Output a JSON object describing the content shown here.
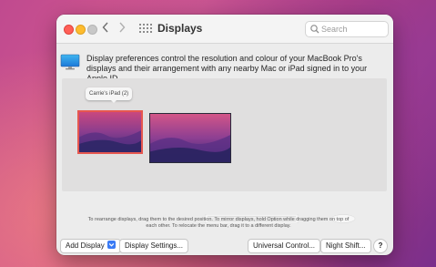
{
  "window": {
    "title": "Displays",
    "search": {
      "placeholder": "Search"
    }
  },
  "description": "Display preferences control the resolution and colour of your MacBook Pro's displays and their arrangement with any nearby Mac or iPad signed in to your Apple ID.",
  "arrangement": {
    "tooltip": "Carrie's iPad (2)",
    "hint": "To rearrange displays, drag them to the desired position. To mirror displays, hold Option while dragging them on top of each other. To relocate the menu bar, drag it to a different display."
  },
  "buttons": {
    "add_display": "Add Display",
    "display_settings": "Display Settings...",
    "universal_control": "Universal Control...",
    "night_shift": "Night Shift...",
    "help": "?"
  },
  "icons": {
    "back": "chevron-left-icon",
    "forward": "chevron-right-icon",
    "grid": "grid-icon",
    "search": "search-icon",
    "display": "display-icon",
    "add_chevron": "chevron-down-icon"
  },
  "colors": {
    "selected_display_border": "#e6574f",
    "accent": "#3a7bf5"
  }
}
